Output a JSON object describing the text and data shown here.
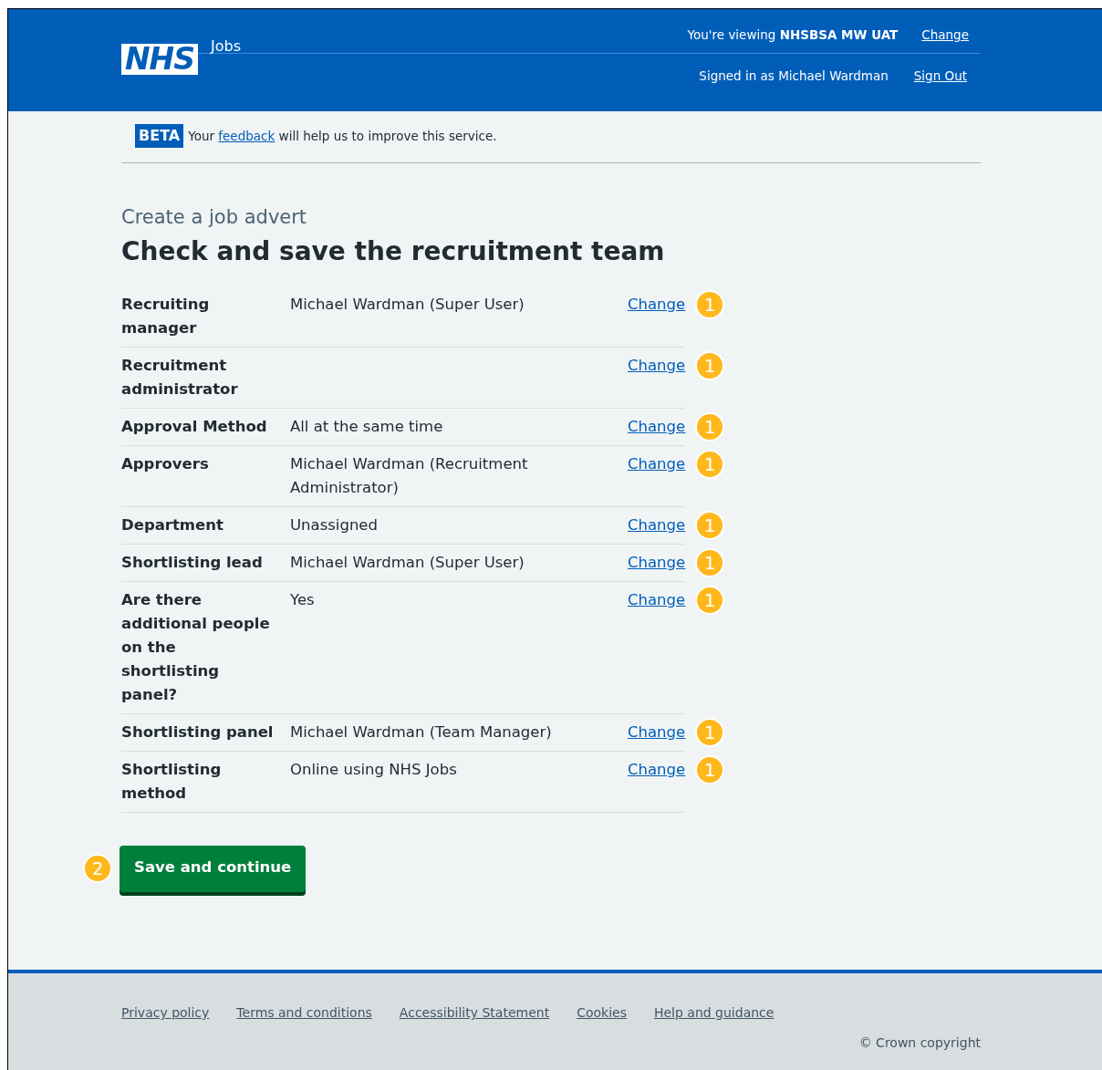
{
  "header": {
    "logo": "NHS",
    "service": "Jobs",
    "viewing_prefix": "You're viewing ",
    "viewing_org": "NHSBSA MW UAT",
    "change_link": "Change",
    "signed_in": "Signed in as Michael Wardman",
    "sign_out": "Sign Out"
  },
  "phase_banner": {
    "tag": "BETA",
    "text_before": "Your",
    "link": "feedback",
    "text_after": "will help us to improve this service."
  },
  "caption": "Create a job advert",
  "title": "Check and save the recruitment team",
  "rows": [
    {
      "key": "Recruiting manager",
      "value": "Michael Wardman (Super User)",
      "action": "Change",
      "marker": "1"
    },
    {
      "key": "Recruitment administrator",
      "value": "",
      "action": "Change",
      "marker": "1"
    },
    {
      "key": "Approval Method",
      "value": "All at the same time",
      "action": "Change",
      "marker": "1"
    },
    {
      "key": "Approvers",
      "value": "Michael Wardman (Recruitment Administrator)",
      "action": "Change",
      "marker": "1"
    },
    {
      "key": "Department",
      "value": "Unassigned",
      "action": "Change",
      "marker": "1"
    },
    {
      "key": "Shortlisting lead",
      "value": "Michael Wardman (Super User)",
      "action": "Change",
      "marker": "1"
    },
    {
      "key": "Are there additional people on the shortlisting panel?",
      "value": "Yes",
      "action": "Change",
      "marker": "1"
    },
    {
      "key": "Shortlisting panel",
      "value": "Michael Wardman (Team Manager)",
      "action": "Change",
      "marker": "1"
    },
    {
      "key": "Shortlisting method",
      "value": "Online using NHS Jobs",
      "action": "Change",
      "marker": "1"
    }
  ],
  "button": {
    "label": "Save and continue",
    "marker": "2"
  },
  "footer": {
    "links": [
      "Privacy policy",
      "Terms and conditions",
      "Accessibility Statement",
      "Cookies",
      "Help and guidance"
    ],
    "copyright": "© Crown copyright"
  }
}
